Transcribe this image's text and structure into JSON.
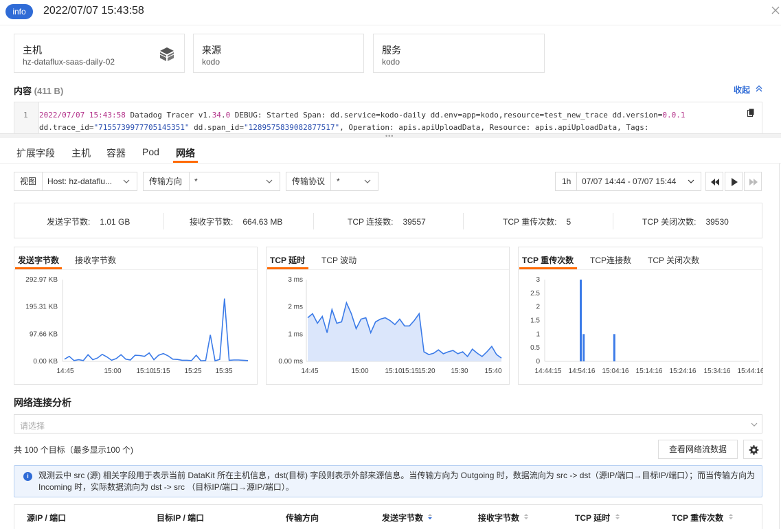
{
  "header": {
    "badge": "info",
    "title": "2022/07/07 15:43:58"
  },
  "info_cards": [
    {
      "label": "主机",
      "value": "hz-dataflux-saas-daily-02"
    },
    {
      "label": "来源",
      "value": "kodo"
    },
    {
      "label": "服务",
      "value": "kodo"
    }
  ],
  "content": {
    "title": "内容",
    "size": "(411 B)",
    "collapse_label": "收起",
    "line_number": "1",
    "line1": {
      "ts": "2022/07/07 15:43:58",
      "p1": " Datadog Tracer v1.",
      "n1": "34",
      "p2": ".",
      "n2": "0",
      "p3": " DEBUG: Started Span: dd.service=kodo-daily dd.env=app=kodo,resource=test_new_trace dd.version=",
      "n3": "0.0.1"
    },
    "line2": {
      "p1": "dd.trace_id=",
      "s1": "\"7155739977705145351\"",
      "p2": " dd.span_id=",
      "s2": "\"1289575839082877517\"",
      "p3": ", Operation: apis.apiUploadData, Resource: apis.apiUploadData, Tags:"
    }
  },
  "tabs": [
    "扩展字段",
    "主机",
    "容器",
    "Pod",
    "网络"
  ],
  "active_tab": "网络",
  "filters": {
    "view_label": "视图",
    "view_value": "Host: hz-dataflu...",
    "direction_label": "传输方向",
    "direction_value": "*",
    "protocol_label": "传输协议",
    "protocol_value": "*",
    "range_short": "1h",
    "range_value": "07/07 14:44 - 07/07 15:44"
  },
  "stats": [
    {
      "label": "发送字节数:",
      "value": "1.01 GB"
    },
    {
      "label": "接收字节数:",
      "value": "664.63 MB"
    },
    {
      "label": "TCP 连接数:",
      "value": "39557"
    },
    {
      "label": "TCP 重传次数:",
      "value": "5"
    },
    {
      "label": "TCP 关闭次数:",
      "value": "39530"
    }
  ],
  "panels": [
    {
      "tabs": [
        "发送字节数",
        "接收字节数"
      ]
    },
    {
      "tabs": [
        "TCP 延时",
        "TCP 波动"
      ]
    },
    {
      "tabs": [
        "TCP 重传次数",
        "TCP连接数",
        "TCP 关闭次数"
      ]
    }
  ],
  "chart_data": [
    {
      "type": "line",
      "title": "",
      "y_ticks": [
        "292.97 KB",
        "195.31 KB",
        "97.66 KB",
        "0.00 KB"
      ],
      "ylim": [
        0,
        292.97
      ],
      "x_ticks": [
        "14:45",
        "15:00",
        "15:10",
        "15:15",
        "15:25",
        "15:35"
      ],
      "series": [
        {
          "values": [
            8,
            18,
            3,
            6,
            3,
            24,
            6,
            12,
            25,
            16,
            4,
            10,
            24,
            8,
            5,
            22,
            21,
            18,
            30,
            6,
            22,
            28,
            20,
            8,
            7,
            4,
            4,
            3,
            22,
            2,
            3,
            95,
            2,
            7,
            225,
            4,
            5,
            5,
            4,
            3
          ]
        }
      ]
    },
    {
      "type": "area",
      "title": "",
      "y_ticks": [
        "3 ms",
        "2 ms",
        "1 ms",
        "0.00 ms"
      ],
      "ylim": [
        0,
        3
      ],
      "x_ticks": [
        "14:45",
        "15:00",
        "15:10",
        "15:15",
        "15:20",
        "15:30",
        "15:40"
      ],
      "series": [
        {
          "values": [
            1.6,
            1.75,
            1.4,
            1.65,
            1.05,
            1.9,
            1.4,
            1.45,
            2.15,
            1.75,
            1.2,
            1.55,
            1.6,
            1.05,
            1.45,
            1.55,
            1.6,
            1.5,
            1.35,
            1.55,
            1.3,
            1.3,
            1.5,
            1.75,
            0.35,
            0.25,
            0.3,
            0.42,
            0.28,
            0.35,
            0.4,
            0.28,
            0.35,
            0.18,
            0.45,
            0.3,
            0.18,
            0.35,
            0.55,
            0.25,
            0.12
          ]
        }
      ]
    },
    {
      "type": "bar",
      "title": "",
      "y_ticks": [
        "3",
        "2.5",
        "2",
        "1.5",
        "1",
        "0.5",
        "0"
      ],
      "ylim": [
        0,
        3
      ],
      "x_ticks": [
        "14:44:15",
        "14:54:16",
        "15:04:16",
        "15:14:16",
        "15:24:16",
        "15:34:16",
        "15:44:16"
      ],
      "bars": [
        {
          "x": "14:53:55",
          "value": 3
        },
        {
          "x": "14:54:46",
          "value": 1
        },
        {
          "x": "15:03:50",
          "value": 1
        }
      ]
    }
  ],
  "network": {
    "section_title": "网络连接分析",
    "select_placeholder": "请选择",
    "count_text": "共 100 个目标（最多显示100 个)",
    "flow_button": "查看网络流数据",
    "notice_icon": "i",
    "notice": "观测云中 src (源) 相关字段用于表示当前 DataKit 所在主机信息，dst(目标) 字段则表示外部来源信息。当传输方向为 Outgoing 时，数据流向为 src -> dst（源IP/端口→目标IP/端口）；而当传输方向为 Incoming 时，实际数据流向为 dst -> src （目标IP/端口→源IP/端口）。",
    "columns": [
      "源IP / 端口",
      "目标IP / 端口",
      "传输方向",
      "发送字节数",
      "接收字节数",
      "TCP 延时",
      "TCP 重传次数"
    ]
  },
  "colors": {
    "accent": "#2f6bd6",
    "tab_underline": "#ff6a00",
    "series": "#3b7be8",
    "area_fill": "#dbe6fb"
  }
}
